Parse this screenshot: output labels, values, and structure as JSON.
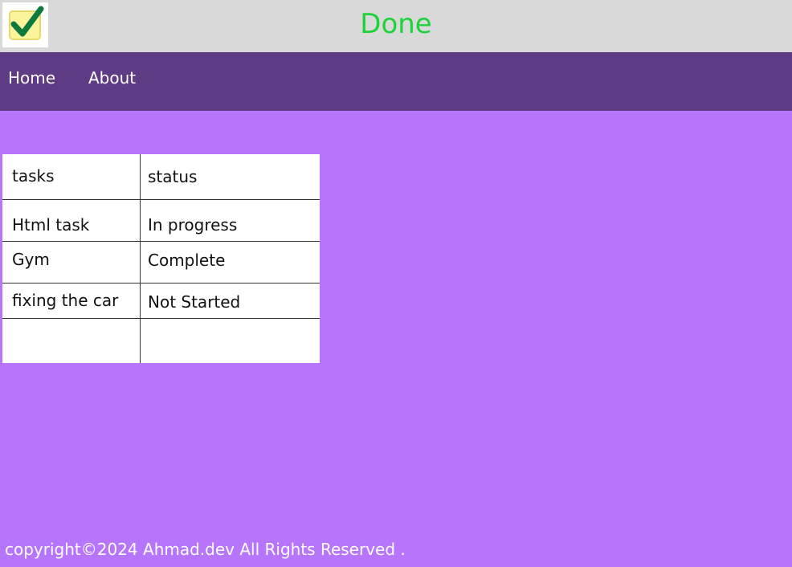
{
  "header": {
    "title": "Done",
    "title_color": "#1ed33a",
    "logo_icon": "checkbox-checked-icon"
  },
  "nav": {
    "items": [
      {
        "label": "Home"
      },
      {
        "label": "About"
      }
    ]
  },
  "tasks_table": {
    "columns": [
      "tasks",
      "status"
    ],
    "rows": [
      {
        "task": "Html task",
        "status": "In progress"
      },
      {
        "task": "Gym",
        "status": "Complete"
      },
      {
        "task": "fixing the car",
        "status": "Not Started"
      },
      {
        "task": "",
        "status": ""
      }
    ]
  },
  "footer": {
    "text": "copyright©2024 Ahmad.dev All Rights Reserved ."
  },
  "colors": {
    "page_background": "#b675fc",
    "header_background": "#d9d9d9",
    "nav_background": "#5e3b84"
  }
}
